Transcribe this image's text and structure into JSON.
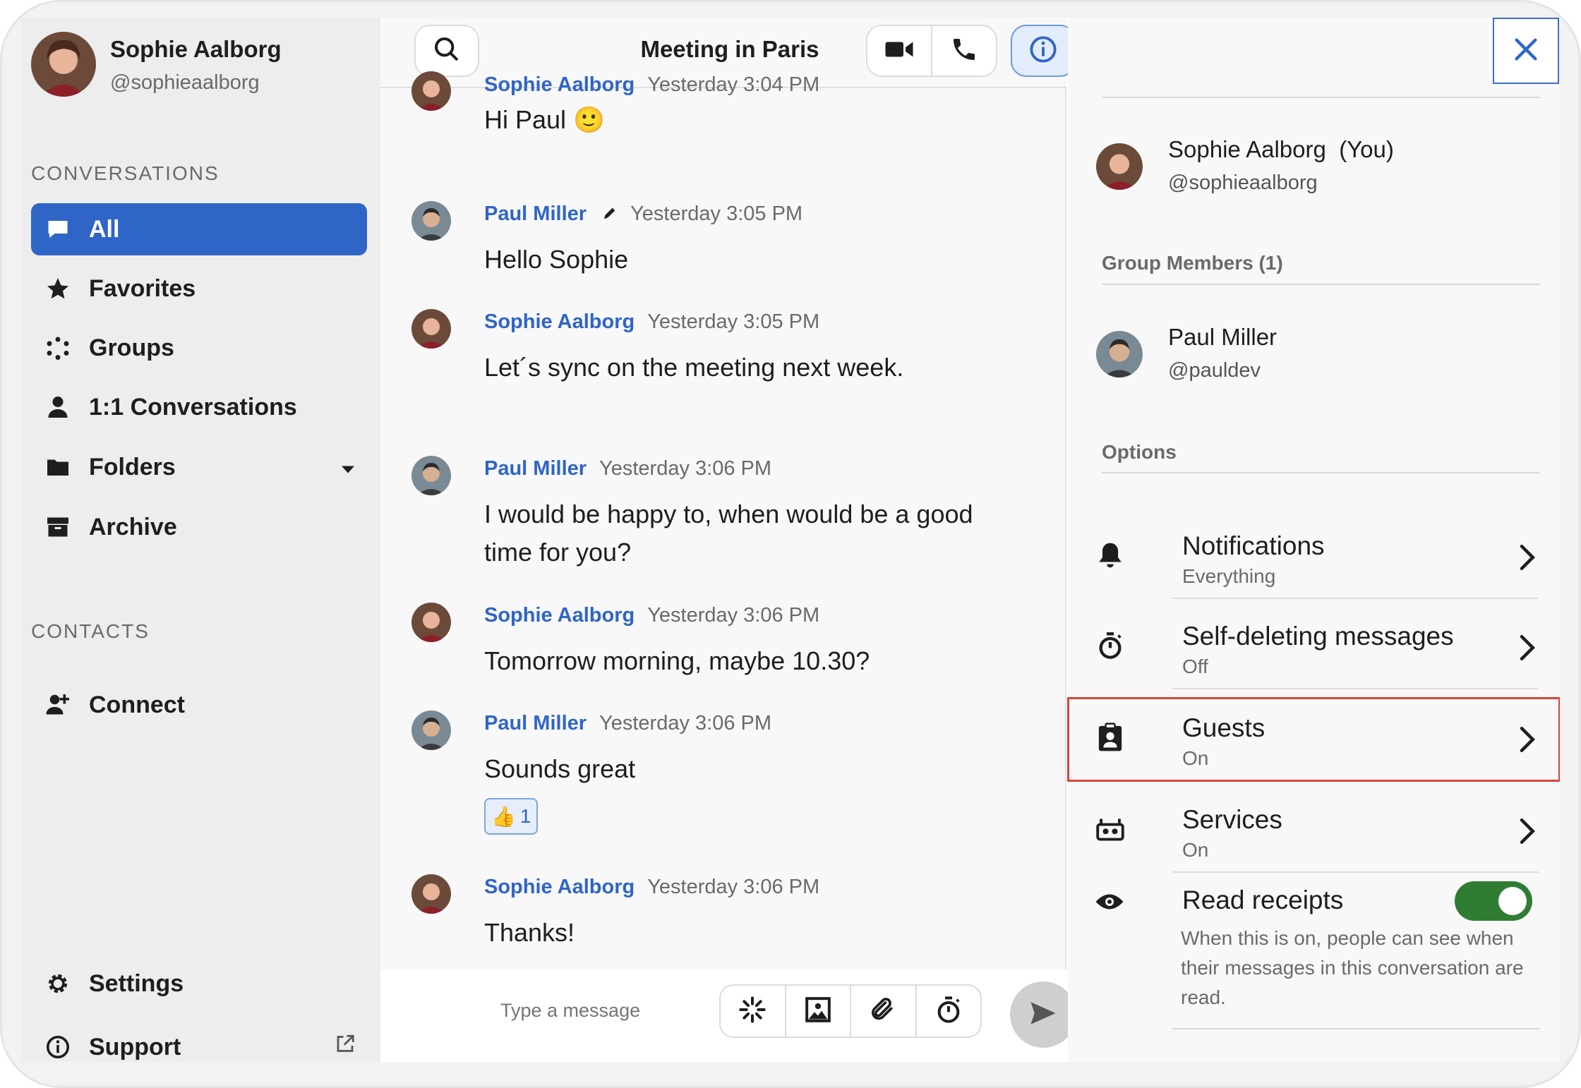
{
  "user": {
    "name": "Sophie Aalborg",
    "handle": "@sophieaalborg"
  },
  "sidebar": {
    "conversations_label": "CONVERSATIONS",
    "items": [
      {
        "label": "All",
        "icon": "chat-bubble-icon",
        "active": true
      },
      {
        "label": "Favorites",
        "icon": "star-icon"
      },
      {
        "label": "Groups",
        "icon": "groups-icon"
      },
      {
        "label": "1:1 Conversations",
        "icon": "person-icon"
      },
      {
        "label": "Folders",
        "icon": "folder-icon"
      },
      {
        "label": "Archive",
        "icon": "archive-icon"
      }
    ],
    "contacts_label": "CONTACTS",
    "connect_label": "Connect",
    "settings_label": "Settings",
    "support_label": "Support"
  },
  "chat": {
    "title": "Meeting in Paris",
    "messages": [
      {
        "author": "Sophie Aalborg",
        "time": "Yesterday 3:04 PM",
        "text": "Hi Paul 🙂"
      },
      {
        "author": "Paul Miller",
        "time": "Yesterday 3:05 PM",
        "text": "Hello Sophie",
        "edited": true
      },
      {
        "author": "Sophie Aalborg",
        "time": "Yesterday 3:05 PM",
        "text": "Let´s sync on the meeting next week."
      },
      {
        "author": "Paul Miller",
        "time": "Yesterday 3:06 PM",
        "text": "I would be happy to, when would be a good time for you?"
      },
      {
        "author": "Sophie Aalborg",
        "time": "Yesterday 3:06 PM",
        "text": "Tomorrow morning, maybe 10.30?"
      },
      {
        "author": "Paul Miller",
        "time": "Yesterday 3:06 PM",
        "text": "Sounds great",
        "reaction": {
          "emoji": "👍",
          "count": "1"
        }
      },
      {
        "author": "Sophie Aalborg",
        "time": "Yesterday 3:06 PM",
        "text": "Thanks!"
      }
    ],
    "composer_placeholder": "Type a message"
  },
  "details": {
    "self": {
      "name": "Sophie Aalborg",
      "suffix": "(You)",
      "handle": "@sophieaalborg"
    },
    "members_heading": "Group Members (1)",
    "member": {
      "name": "Paul Miller",
      "handle": "@pauldev"
    },
    "options_heading": "Options",
    "options": [
      {
        "title": "Notifications",
        "value": "Everything",
        "icon": "bell-icon"
      },
      {
        "title": "Self-deleting messages",
        "value": "Off",
        "icon": "timer-icon"
      },
      {
        "title": "Guests",
        "value": "On",
        "icon": "guest-badge-icon",
        "highlighted": true
      },
      {
        "title": "Services",
        "value": "On",
        "icon": "robot-icon"
      }
    ],
    "read_receipts": {
      "title": "Read receipts",
      "enabled": true,
      "description": "When this is on, people can see when their messages in this conversation are read."
    }
  },
  "colors": {
    "accent": "#2f65c7",
    "toggle_on": "#2f7c33",
    "highlight": "#d9453a"
  }
}
